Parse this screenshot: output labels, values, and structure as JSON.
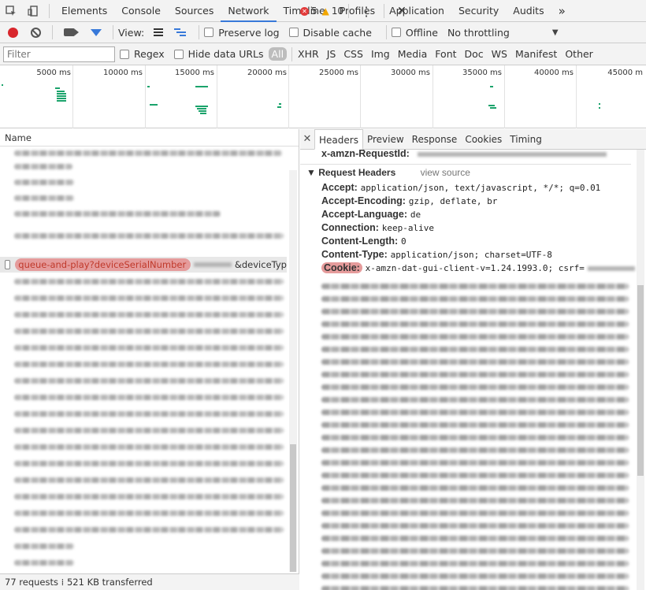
{
  "tabs": [
    "Elements",
    "Console",
    "Sources",
    "Network",
    "Timeline",
    "Profiles",
    "Application",
    "Security",
    "Audits"
  ],
  "active_tab": "Network",
  "more_tabs": "»",
  "errors_count": "5",
  "warnings_count": "10",
  "kebab": "⋮",
  "close": "✕",
  "toolbar": {
    "view_label": "View:",
    "preserve_log": "Preserve log",
    "disable_cache": "Disable cache",
    "offline": "Offline",
    "throttling": "No throttling",
    "dropdown_arrow": "▼"
  },
  "filter": {
    "placeholder": "Filter",
    "regex": "Regex",
    "hide_data_urls": "Hide data URLs",
    "types": [
      "All",
      "XHR",
      "JS",
      "CSS",
      "Img",
      "Media",
      "Font",
      "Doc",
      "WS",
      "Manifest",
      "Other"
    ]
  },
  "overview_ticks": [
    "5000 ms",
    "10000 ms",
    "15000 ms",
    "20000 ms",
    "25000 ms",
    "30000 ms",
    "35000 ms",
    "40000 ms",
    "45000 m"
  ],
  "left": {
    "column_header": "Name",
    "highlighted_name": "queue-and-play?deviceSerialNumber",
    "highlighted_rest": "&deviceTyp",
    "status": "77 requests  ⁞  521 KB transferred"
  },
  "right": {
    "close": "✕",
    "tabs": [
      "Headers",
      "Preview",
      "Response",
      "Cookies",
      "Timing"
    ],
    "active_tab": "Headers",
    "top_header_key": "x-amzn-RequestId:",
    "section_title": "▼ Request Headers",
    "view_source": "view source",
    "headers": [
      {
        "key": "Accept:",
        "value": "application/json, text/javascript, */*; q=0.01"
      },
      {
        "key": "Accept-Encoding:",
        "value": "gzip, deflate, br"
      },
      {
        "key": "Accept-Language:",
        "value": "de"
      },
      {
        "key": "Connection:",
        "value": "keep-alive"
      },
      {
        "key": "Content-Length:",
        "value": "0"
      },
      {
        "key": "Content-Type:",
        "value": "application/json; charset=UTF-8"
      }
    ],
    "cookie_key": "Cookie:",
    "cookie_value": "x-amzn-dat-gui-client-v=1.24.1993.0; csrf="
  },
  "colors": {
    "accent": "#3879d9",
    "record": "#d8262c",
    "highlight": "#e59b9b",
    "waterfall": "#1aa36b"
  }
}
